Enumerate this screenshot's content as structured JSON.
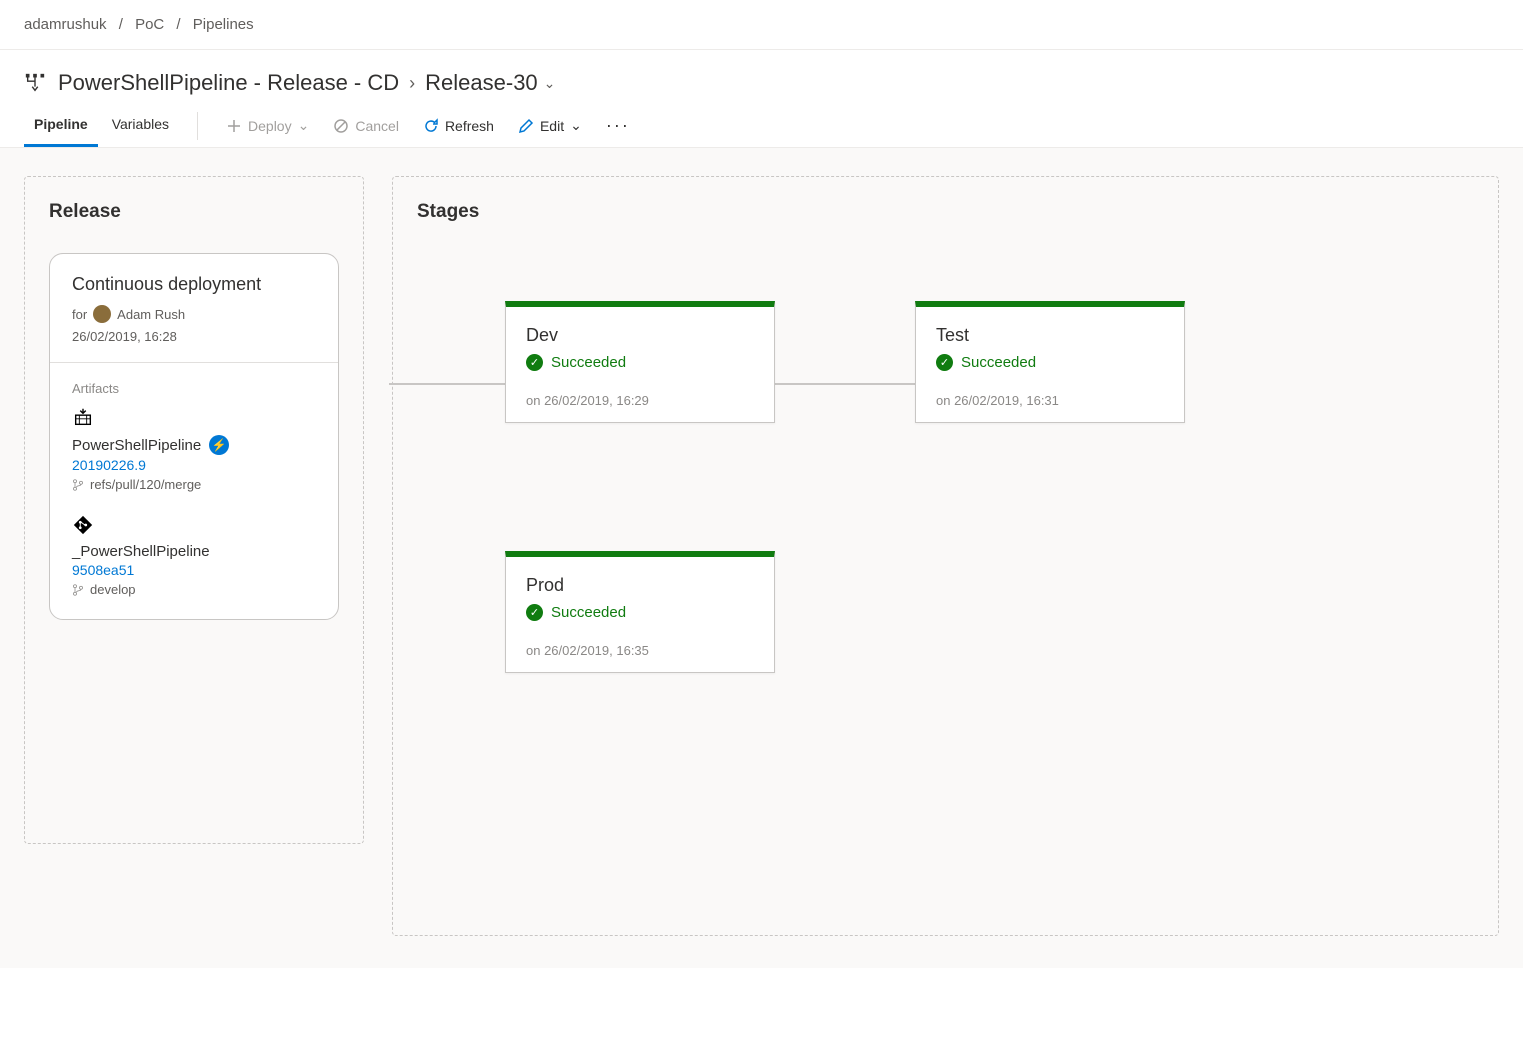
{
  "breadcrumb": {
    "org": "adamrushuk",
    "project": "PoC",
    "section": "Pipelines"
  },
  "title": {
    "pipeline": "PowerShellPipeline - Release - CD",
    "release": "Release-30"
  },
  "tabs": {
    "pipeline": "Pipeline",
    "variables": "Variables"
  },
  "toolbar": {
    "deploy": "Deploy",
    "cancel": "Cancel",
    "refresh": "Refresh",
    "edit": "Edit"
  },
  "release": {
    "panel_title": "Release",
    "card_title": "Continuous deployment",
    "for_prefix": "for",
    "user": "Adam Rush",
    "timestamp": "26/02/2019, 16:28",
    "artifacts_label": "Artifacts",
    "artifacts": [
      {
        "name": "PowerShellPipeline",
        "version": "20190226.9",
        "branch": "refs/pull/120/merge",
        "bolt": true,
        "type": "build"
      },
      {
        "name": "_PowerShellPipeline",
        "version": "9508ea51",
        "branch": "develop",
        "bolt": false,
        "type": "git"
      }
    ]
  },
  "stages": {
    "panel_title": "Stages",
    "items": [
      {
        "name": "Dev",
        "status": "Succeeded",
        "time": "on 26/02/2019, 16:29"
      },
      {
        "name": "Test",
        "status": "Succeeded",
        "time": "on 26/02/2019, 16:31"
      },
      {
        "name": "Prod",
        "status": "Succeeded",
        "time": "on 26/02/2019, 16:35"
      }
    ]
  }
}
